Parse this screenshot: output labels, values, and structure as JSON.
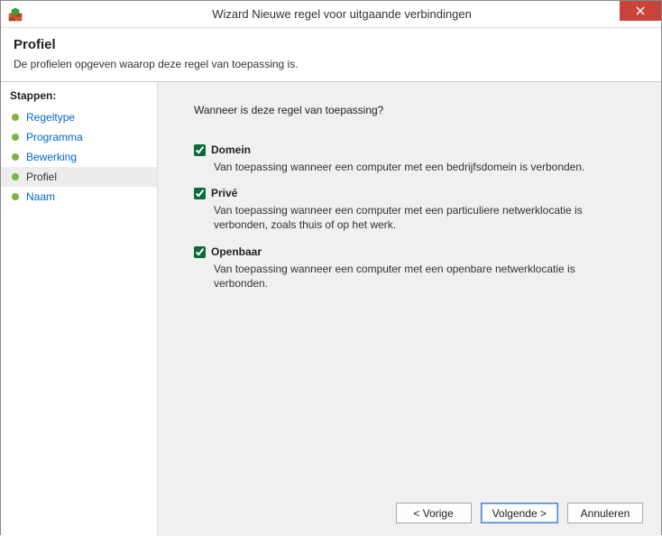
{
  "window": {
    "title": "Wizard Nieuwe regel voor uitgaande verbindingen"
  },
  "header": {
    "heading": "Profiel",
    "subheading": "De profielen opgeven waarop deze regel van toepassing is."
  },
  "sidebar": {
    "heading": "Stappen:",
    "steps": [
      {
        "label": "Regeltype",
        "active": false
      },
      {
        "label": "Programma",
        "active": false
      },
      {
        "label": "Bewerking",
        "active": false
      },
      {
        "label": "Profiel",
        "active": true
      },
      {
        "label": "Naam",
        "active": false
      }
    ]
  },
  "main": {
    "question": "Wanneer is deze regel van toepassing?",
    "options": [
      {
        "key": "domain",
        "label": "Domein",
        "checked": true,
        "description": "Van toepassing wanneer een computer met een bedrijfsdomein is verbonden."
      },
      {
        "key": "private",
        "label": "Privé",
        "checked": true,
        "description": "Van toepassing wanneer een computer met een particuliere netwerklocatie is verbonden, zoals thuis of op het werk."
      },
      {
        "key": "public",
        "label": "Openbaar",
        "checked": true,
        "description": "Van toepassing wanneer een computer met een openbare netwerklocatie is verbonden."
      }
    ]
  },
  "buttons": {
    "back": "< Vorige",
    "next": "Volgende >",
    "cancel": "Annuleren"
  }
}
